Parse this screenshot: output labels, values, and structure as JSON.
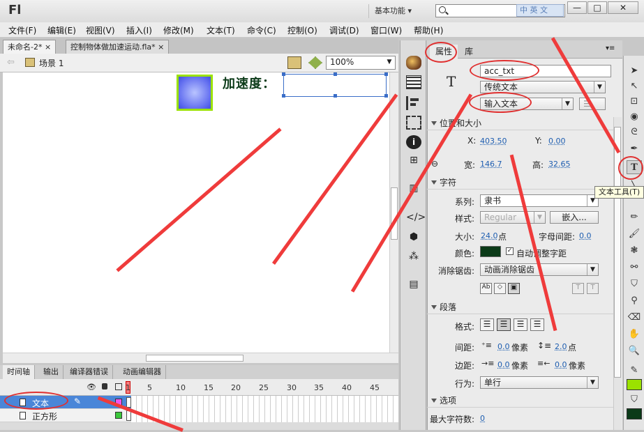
{
  "app": {
    "logo": "Fl",
    "workspace": "基本功能",
    "ime": "中 英 文"
  },
  "window_buttons": {
    "minimize": "—",
    "maximize": "□",
    "close": "✕"
  },
  "menu": [
    "文件(F)",
    "编辑(E)",
    "视图(V)",
    "插入(I)",
    "修改(M)",
    "文本(T)",
    "命令(C)",
    "控制(O)",
    "调试(D)",
    "窗口(W)",
    "帮助(H)"
  ],
  "tabs": [
    {
      "label": "未命名-2*",
      "close": "×"
    },
    {
      "label": "控制物体做加速运动.fla*",
      "close": "×"
    }
  ],
  "scene": {
    "label": "场景 1",
    "zoom": "100%"
  },
  "stage": {
    "label_text": "加速度："
  },
  "timeline": {
    "tabs": [
      "时间轴",
      "输出",
      "编译器错误",
      "动画编辑器"
    ],
    "frame_numbers": [
      "1",
      "5",
      "10",
      "15",
      "20",
      "25",
      "30",
      "35",
      "40",
      "45"
    ],
    "layers": [
      {
        "name": "文本"
      },
      {
        "name": "正方形"
      }
    ]
  },
  "properties": {
    "tabs": [
      "属性",
      "库"
    ],
    "instance_name": "acc_txt",
    "text_engine": "传统文本",
    "text_type": "输入文本",
    "type_icon": "T",
    "section_pos": "位置和大小",
    "x_label": "X:",
    "x_value": "403.50",
    "y_label": "Y:",
    "y_value": "0.00",
    "w_label": "宽:",
    "w_value": "146.7",
    "h_label": "高:",
    "h_value": "32.65",
    "section_char": "字符",
    "family_label": "系列:",
    "family_value": "隶书",
    "style_label": "样式:",
    "style_value": "Regular",
    "embed_label": "嵌入...",
    "size_label": "大小:",
    "size_value": "24.0",
    "size_unit": "点",
    "spacing_label": "字母间距:",
    "spacing_value": "0.0",
    "color_label": "颜色:",
    "auto_kern": "自动调整字距",
    "aa_label": "消除锯齿:",
    "aa_value": "动画消除锯齿",
    "section_para": "段落",
    "format_label": "格式:",
    "gap_label": "间距:",
    "gap_value1": "0.0",
    "gap_unit1": "像素",
    "gap_value2": "2.0",
    "gap_unit2": "点",
    "margin_label": "边距:",
    "margin_value1": "0.0",
    "margin_unit1": "像素",
    "margin_value2": "0.0",
    "margin_unit2": "像素",
    "behavior_label": "行为:",
    "behavior_value": "单行",
    "section_options": "选项",
    "maxchars_label": "最大字符数:",
    "maxchars_value": "0"
  },
  "tooltip": "文本工具(T)",
  "colors": {
    "text_color": "#0b3a18",
    "fill_green": "#9be200",
    "accent_red": "#e03030"
  }
}
